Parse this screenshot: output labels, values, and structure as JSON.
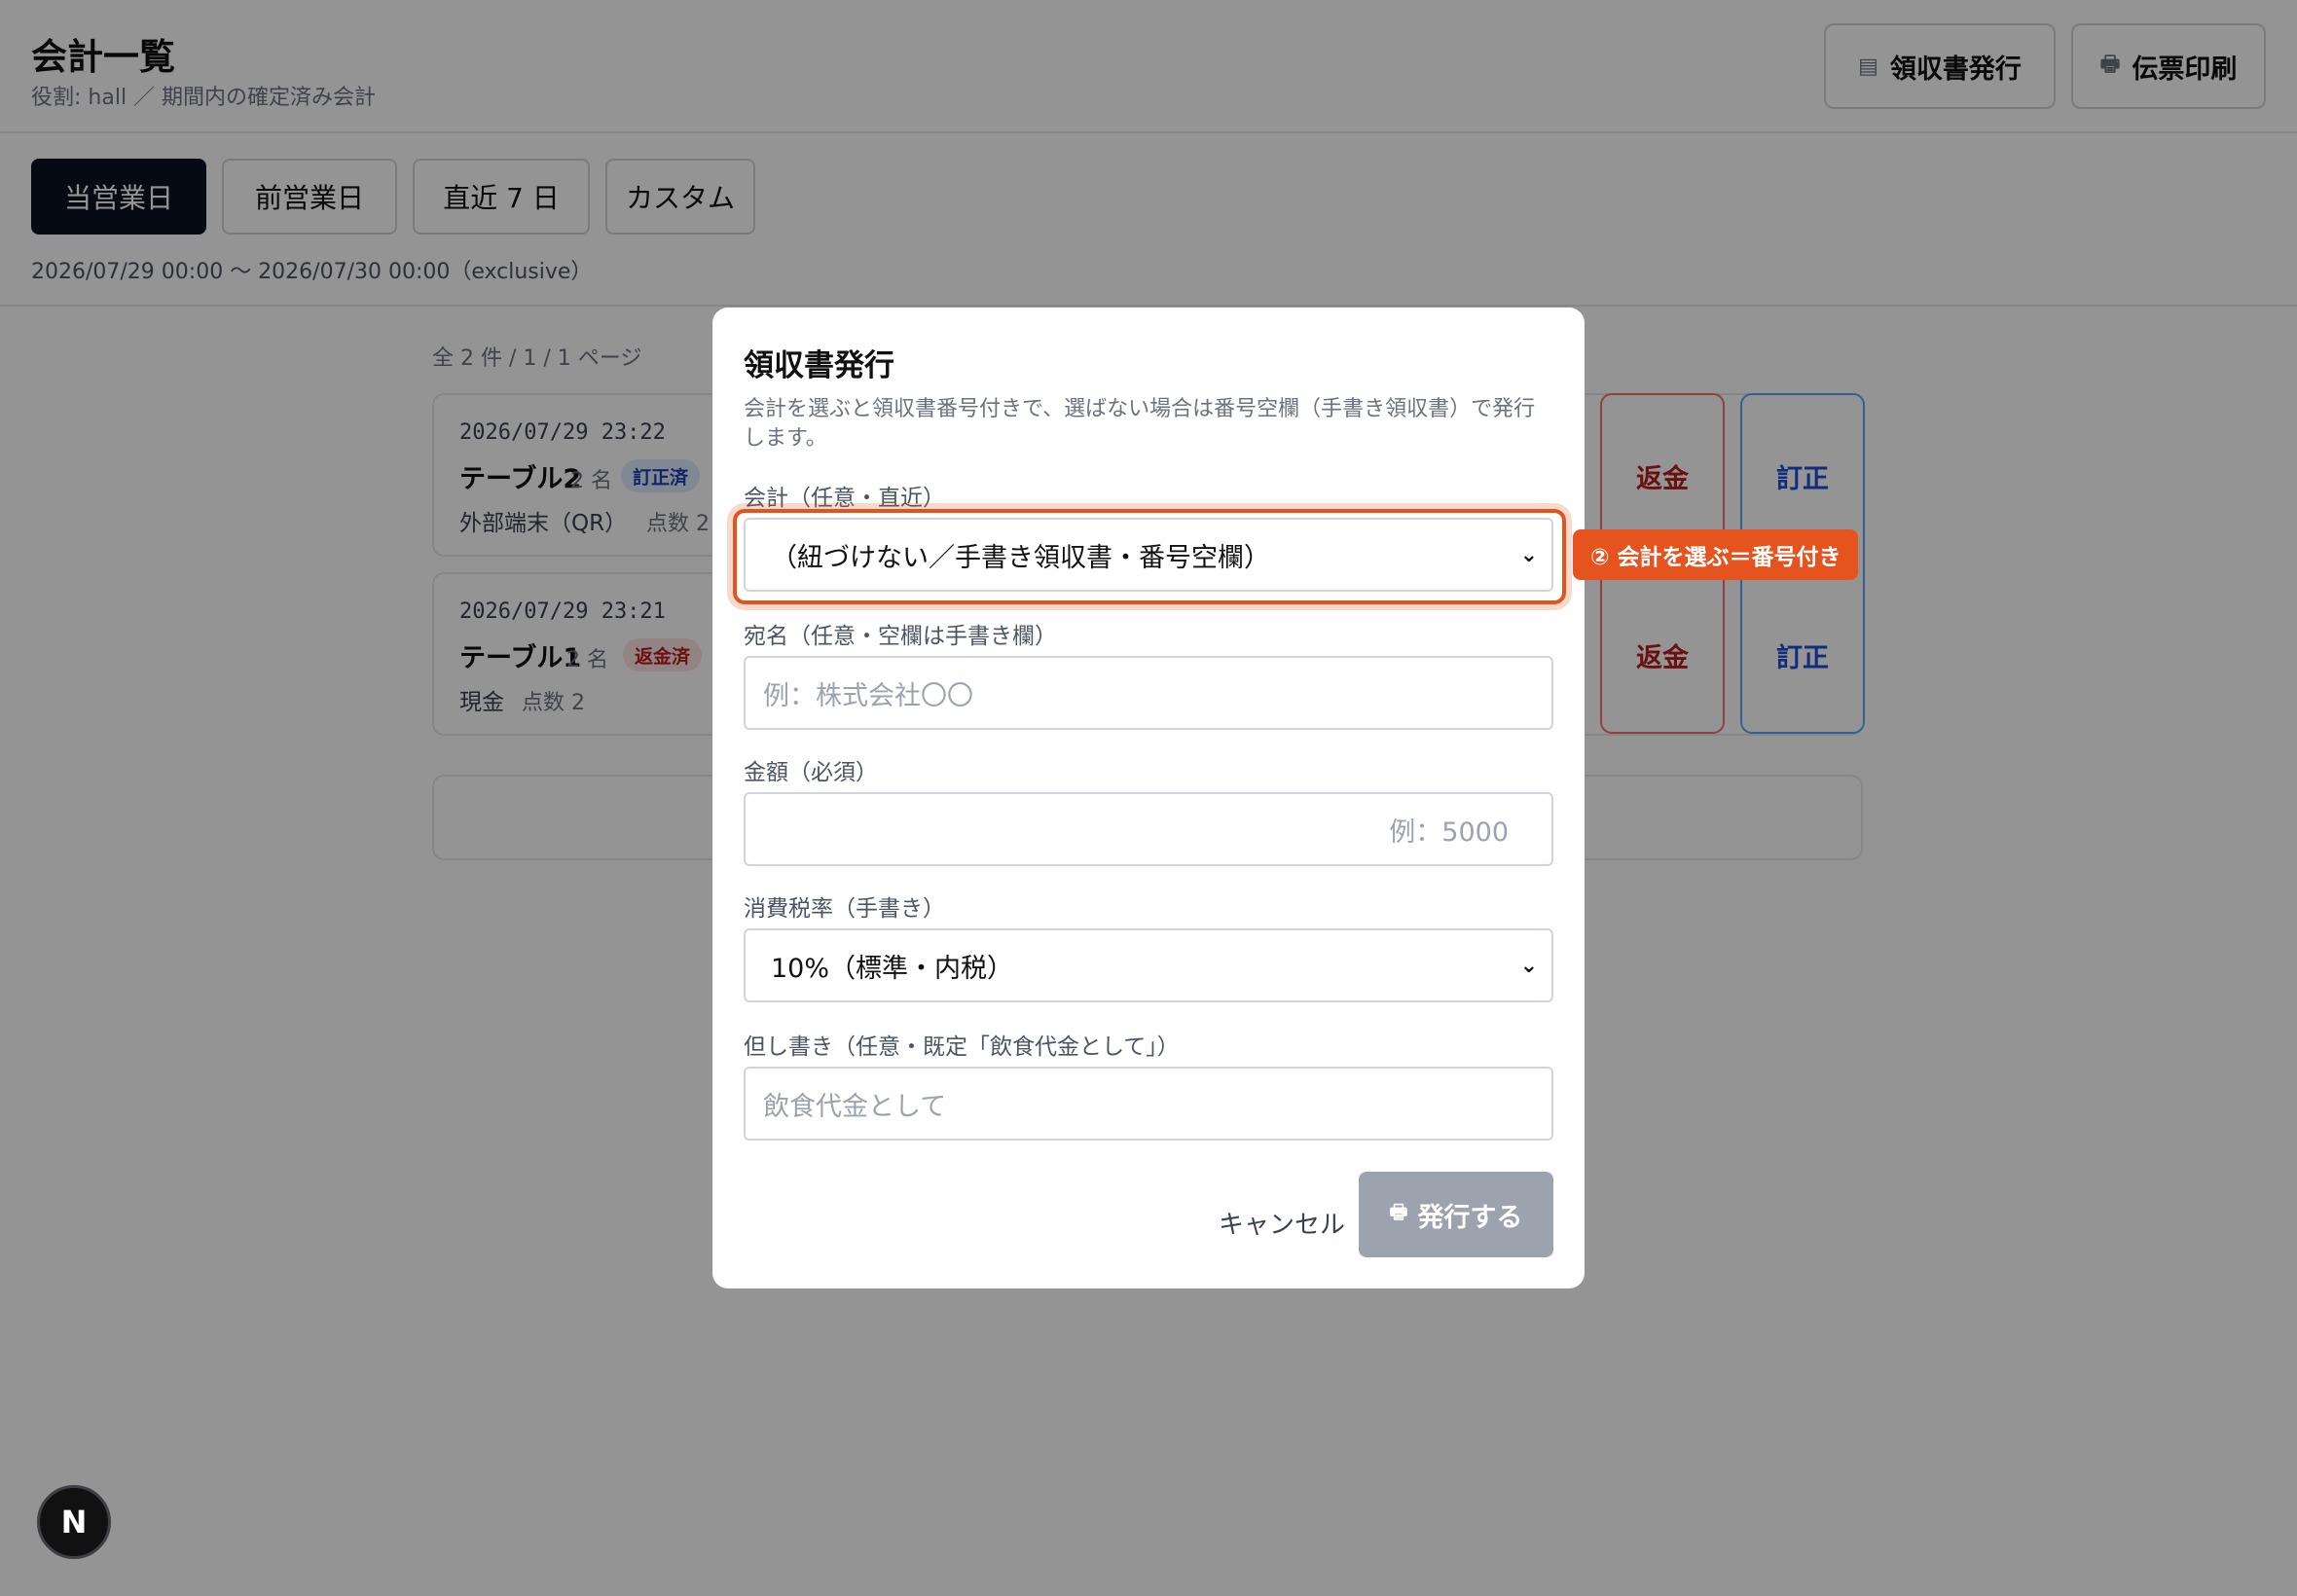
{
  "header": {
    "title": "会計一覧",
    "subtitle": "役割: hall ／ 期間内の確定済み会計",
    "receipt_button": "領収書発行",
    "receipt_icon": "receipt-icon",
    "slip_button": "伝票印刷",
    "slip_icon": "printer-icon"
  },
  "range": {
    "tabs": [
      "当営業日",
      "前営業日",
      "直近 7 日",
      "カスタム"
    ],
    "active_tab": "当営業日",
    "period_text": "2026/07/29 00:00 〜 2026/07/30 00:00（exclusive）"
  },
  "list": {
    "count_text": "全 2 件 / 1 / 1 ページ",
    "rows": [
      {
        "time": "2026/07/29 23:22",
        "table": "テーブル2",
        "guests": "2 名",
        "badge": "訂正済",
        "payment": "外部端末（QR）",
        "items": "点数 2"
      },
      {
        "time": "2026/07/29 23:21",
        "table": "テーブル1",
        "guests": "2 名",
        "badge": "返金済",
        "payment": "現金",
        "items": "点数 2"
      }
    ],
    "refund_label": "返金",
    "fix_label": "訂正"
  },
  "modal": {
    "title": "領収書発行",
    "description": "会計を選ぶと領収書番号付きで、選ばない場合は番号空欄（手書き領収書）で発行します。",
    "account_label": "会計（任意・直近）",
    "account_value": "（紐づけない／手書き領収書・番号空欄）",
    "addressee_label": "宛名（任意・空欄は手書き欄）",
    "addressee_placeholder": "例：株式会社〇〇",
    "amount_label": "金額（必須）",
    "amount_placeholder": "例：5000",
    "tax_label": "消費税率（手書き）",
    "tax_value": "10%（標準・内税）",
    "note_label": "但し書き（任意・既定「飲食代金として」）",
    "note_placeholder": "飲食代金として",
    "cancel_label": "キャンセル",
    "submit_label": "発行する",
    "submit_icon": "printer-icon"
  },
  "callout": {
    "text": "② 会計を選ぶ＝番号付き",
    "color": "#e5541e"
  },
  "dev_badge": "N"
}
